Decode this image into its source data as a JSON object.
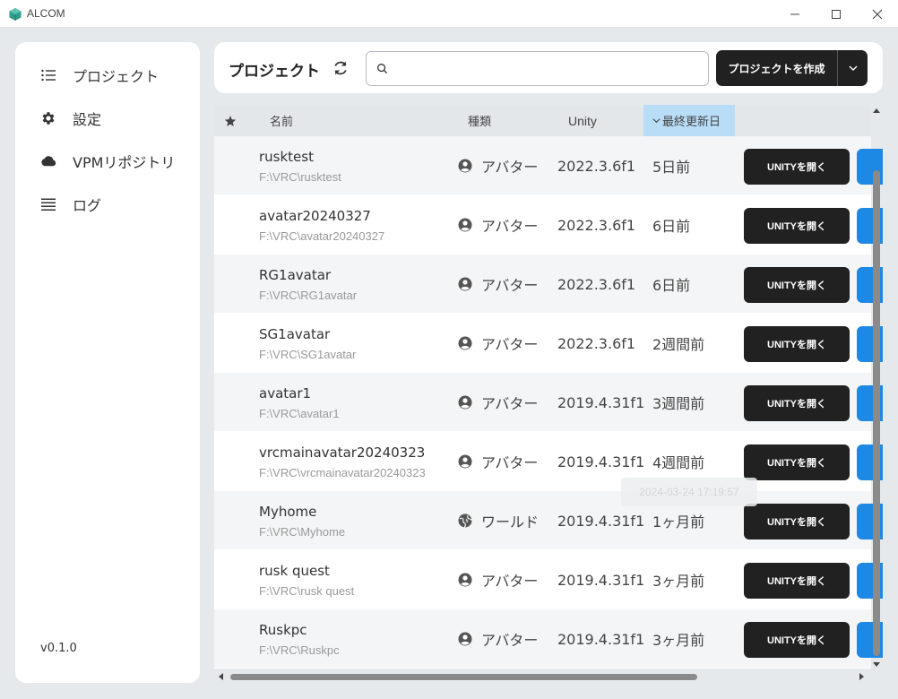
{
  "window": {
    "title": "ALCOM",
    "accent": "#2e9d8a"
  },
  "sidebar": {
    "items": [
      {
        "label": "プロジェクト",
        "icon": "list-icon"
      },
      {
        "label": "設定",
        "icon": "gear-icon"
      },
      {
        "label": "VPMリポジトリ",
        "icon": "cloud-icon"
      },
      {
        "label": "ログ",
        "icon": "lines-icon"
      }
    ],
    "version": "v0.1.0"
  },
  "header": {
    "title": "プロジェクト",
    "search_value": "",
    "search_placeholder": "",
    "create_label": "プロジェクトを作成"
  },
  "table": {
    "columns": {
      "name": "名前",
      "type": "種類",
      "unity": "Unity",
      "date": "最終更新日"
    },
    "sorted_by": "date",
    "open_label": "UNITYを開く",
    "rows": [
      {
        "name": "rusktest",
        "path": "F:\\VRC\\rusktest",
        "type": "アバター",
        "type_icon": "user-icon",
        "unity": "2022.3.6f1",
        "date": "5日前"
      },
      {
        "name": "avatar20240327",
        "path": "F:\\VRC\\avatar20240327",
        "type": "アバター",
        "type_icon": "user-icon",
        "unity": "2022.3.6f1",
        "date": "6日前"
      },
      {
        "name": "RG1avatar",
        "path": "F:\\VRC\\RG1avatar",
        "type": "アバター",
        "type_icon": "user-icon",
        "unity": "2022.3.6f1",
        "date": "6日前"
      },
      {
        "name": "SG1avatar",
        "path": "F:\\VRC\\SG1avatar",
        "type": "アバター",
        "type_icon": "user-icon",
        "unity": "2022.3.6f1",
        "date": "2週間前"
      },
      {
        "name": "avatar1",
        "path": "F:\\VRC\\avatar1",
        "type": "アバター",
        "type_icon": "user-icon",
        "unity": "2019.4.31f1",
        "date": "3週間前"
      },
      {
        "name": "vrcmainavatar20240323",
        "path": "F:\\VRC\\vrcmainavatar20240323",
        "type": "アバター",
        "type_icon": "user-icon",
        "unity": "2019.4.31f1",
        "date": "4週間前"
      },
      {
        "name": "Myhome",
        "path": "F:\\VRC\\Myhome",
        "type": "ワールド",
        "type_icon": "globe-icon",
        "unity": "2019.4.31f1",
        "date": "1ヶ月前"
      },
      {
        "name": "rusk quest",
        "path": "F:\\VRC\\rusk quest",
        "type": "アバター",
        "type_icon": "user-icon",
        "unity": "2019.4.31f1",
        "date": "3ヶ月前"
      },
      {
        "name": "Ruskpc",
        "path": "F:\\VRC\\Ruskpc",
        "type": "アバター",
        "type_icon": "user-icon",
        "unity": "2019.4.31f1",
        "date": "3ヶ月前"
      }
    ]
  },
  "tooltip": {
    "text": "2024-03-24 17:19:57"
  }
}
